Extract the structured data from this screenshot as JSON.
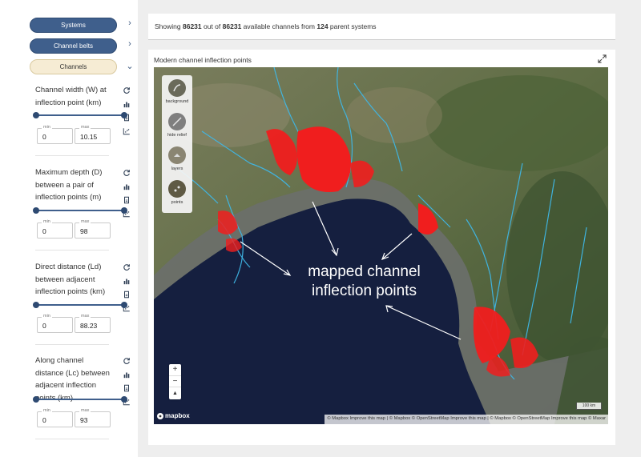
{
  "sidebar": {
    "nav": [
      {
        "label": "Systems",
        "active": false
      },
      {
        "label": "Channel belts",
        "active": false
      },
      {
        "label": "Channels",
        "active": true
      }
    ],
    "filters": [
      {
        "label": "Channel width (W) at inflection point (km)",
        "min_caption": "min",
        "max_caption": "max",
        "min": "0",
        "max": "10.15"
      },
      {
        "label": "Maximum depth (D) between a pair of inflection points (m)",
        "min_caption": "min",
        "max_caption": "max",
        "min": "0",
        "max": "98"
      },
      {
        "label": "Direct distance (Ld) between adjacent inflection points (km)",
        "min_caption": "min",
        "max_caption": "max",
        "min": "0",
        "max": "88.23"
      },
      {
        "label": "Along channel distance (Lc) between adjacent inflection points (km)",
        "min_caption": "min",
        "max_caption": "max",
        "min": "0",
        "max": "93"
      }
    ]
  },
  "info": {
    "prefix": "Showing",
    "shown": "86231",
    "middle": "out of",
    "total": "86231",
    "middle2": "available channels from",
    "parents": "124",
    "suffix": "parent systems"
  },
  "map": {
    "title": "Modern channel inflection points",
    "controls": [
      {
        "label": "background",
        "icon": "background-icon"
      },
      {
        "label": "hide relief",
        "icon": "relief-icon"
      },
      {
        "label": "layers",
        "icon": "layers-icon"
      },
      {
        "label": "points",
        "icon": "points-icon"
      }
    ],
    "zoom_in": "+",
    "zoom_out": "−",
    "compass": "▲",
    "scale_label": "100 km",
    "logo_text": "mapbox",
    "attribution": "© Mapbox  Improve this map | © Mapbox © OpenStreetMap  Improve this map | © Mapbox © OpenStreetMap  Improve this map © Maxar",
    "annotation": "mapped channel inflection points",
    "colors": {
      "points": "#f01e1e",
      "channels": "#3fb7e6",
      "sea": "#151f3f"
    }
  }
}
